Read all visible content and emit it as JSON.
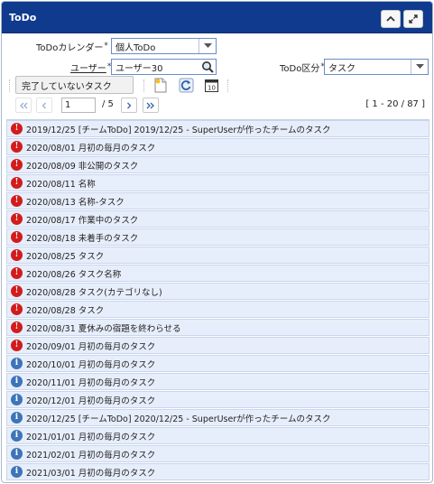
{
  "window": {
    "title": "ToDo"
  },
  "form": {
    "calendar_label": "ToDoカレンダー",
    "calendar_value": "個人ToDo",
    "user_label": "ユーザー",
    "user_value": "ユーザー30",
    "category_label": "ToDo区分",
    "category_value": "タスク",
    "required_mark": "*"
  },
  "toolbar": {
    "filter_label": "完了していないタスク"
  },
  "pager": {
    "current_page": "1",
    "total_pages": "/ 5",
    "range": "[ 1 - 20 / 87 ]"
  },
  "items": [
    {
      "status": "alert",
      "text": "2019/12/25 [チームToDo] 2019/12/25 - SuperUserが作ったチームのタスク"
    },
    {
      "status": "alert",
      "text": "2020/08/01 月初の毎月のタスク"
    },
    {
      "status": "alert",
      "text": "2020/08/09 非公開のタスク"
    },
    {
      "status": "alert",
      "text": "2020/08/11 名称"
    },
    {
      "status": "alert",
      "text": "2020/08/13 名称-タスク"
    },
    {
      "status": "alert",
      "text": "2020/08/17 作業中のタスク"
    },
    {
      "status": "alert",
      "text": "2020/08/18 未着手のタスク"
    },
    {
      "status": "alert",
      "text": "2020/08/25 タスク"
    },
    {
      "status": "alert",
      "text": "2020/08/26 タスク名称"
    },
    {
      "status": "alert",
      "text": "2020/08/28 タスク(カテゴリなし)"
    },
    {
      "status": "alert",
      "text": "2020/08/28 タスク"
    },
    {
      "status": "alert",
      "text": "2020/08/31 夏休みの宿題を終わらせる"
    },
    {
      "status": "alert",
      "text": "2020/09/01 月初の毎月のタスク"
    },
    {
      "status": "info",
      "text": "2020/10/01 月初の毎月のタスク"
    },
    {
      "status": "info",
      "text": "2020/11/01 月初の毎月のタスク"
    },
    {
      "status": "info",
      "text": "2020/12/01 月初の毎月のタスク"
    },
    {
      "status": "info",
      "text": "2020/12/25 [チームToDo] 2020/12/25 - SuperUserが作ったチームのタスク"
    },
    {
      "status": "info",
      "text": "2021/01/01 月初の毎月のタスク"
    },
    {
      "status": "info",
      "text": "2021/02/01 月初の毎月のタスク"
    },
    {
      "status": "info",
      "text": "2021/03/01 月初の毎月のタスク"
    }
  ],
  "icons": {
    "alert": "exclamation-circle-icon",
    "info": "info-circle-icon"
  },
  "colors": {
    "header": "#103a8e",
    "row_bg": "#e7eefb",
    "alert": "#d21c1c",
    "info": "#3e74b8"
  }
}
